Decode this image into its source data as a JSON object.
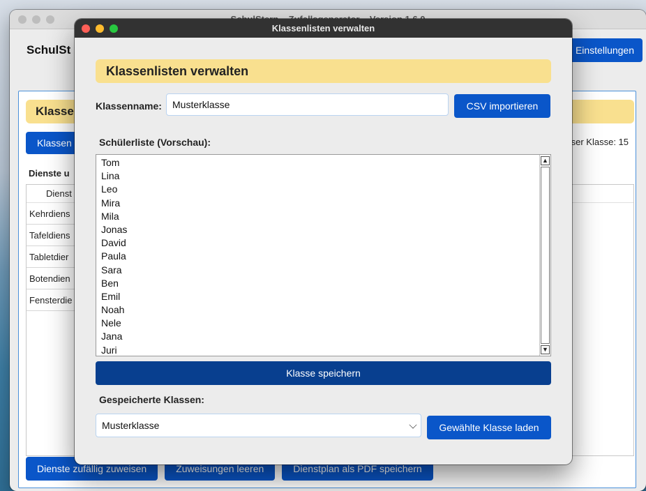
{
  "background_window": {
    "title": "SchulStern – Zufallsgenerator – Version 1.6.0",
    "app_title": "SchulSt",
    "settings_label": "Einstellungen",
    "panel_header": "Klasse",
    "classes_button": "Klassen",
    "count_label": "ser Klasse: 15",
    "section_label": "Dienste u",
    "column_header": "Dienst",
    "duty_rows": [
      "Kehrdiens",
      "Tafeldiens",
      "Tabletdier",
      "Botendien",
      "Fensterdie"
    ],
    "footer_buttons": [
      "Dienste zufällig zuweisen",
      "Zuweisungen leeren",
      "Dienstplan als PDF speichern"
    ]
  },
  "dialog": {
    "window_title": "Klassenlisten verwalten",
    "header": "Klassenlisten verwalten",
    "class_name_label": "Klassenname:",
    "class_name_value": "Musterklasse",
    "csv_import_label": "CSV importieren",
    "student_list_label": "Schülerliste (Vorschau):",
    "students": [
      "Tom",
      "Lina",
      "Leo",
      "Mira",
      "Mila",
      "Jonas",
      "David",
      "Paula",
      "Sara",
      "Ben",
      "Emil",
      "Noah",
      "Nele",
      "Jana",
      "Juri"
    ],
    "save_class_label": "Klasse speichern",
    "saved_classes_label": "Gespeicherte Klassen:",
    "selected_class": "Musterklasse",
    "load_class_label": "Gewählte Klasse laden"
  },
  "colors": {
    "accent_blue": "#0a56c9",
    "dark_blue": "#083f8f",
    "header_yellow": "#f9e08f"
  }
}
